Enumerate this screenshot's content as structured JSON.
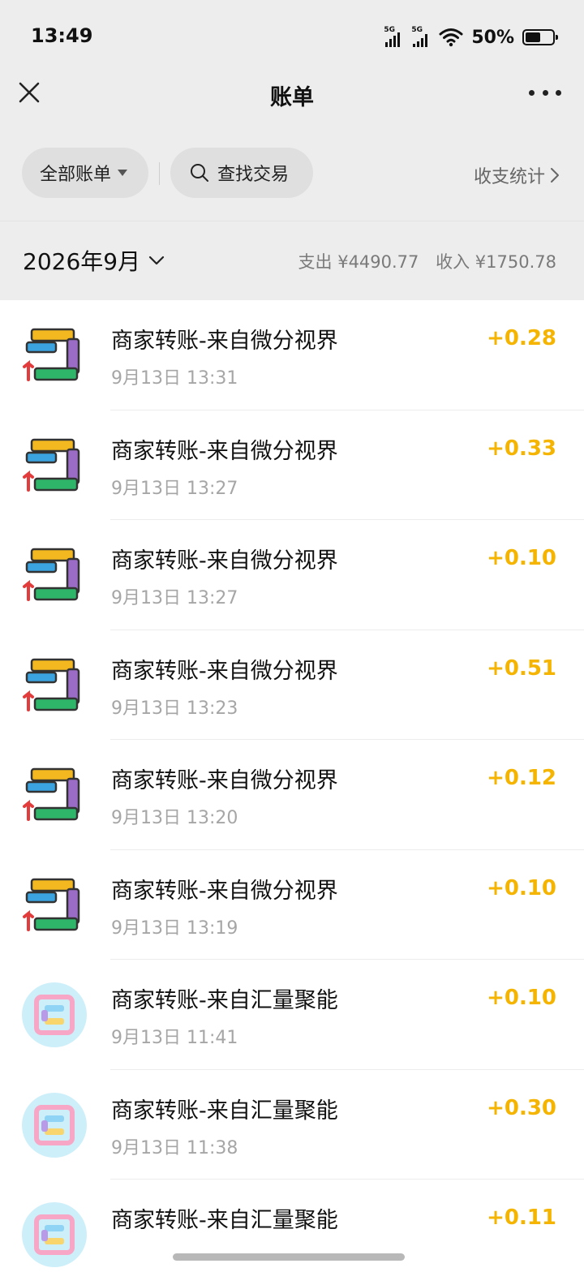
{
  "status_bar": {
    "time": "13:49",
    "signal_1": "5G",
    "signal_2": "5G",
    "battery": "50%"
  },
  "nav": {
    "title": "账单"
  },
  "filters": {
    "all_bills": "全部账单",
    "search": "查找交易",
    "stats": "收支统计"
  },
  "month": {
    "label": "2026年9月",
    "expense": "支出 ¥4490.77",
    "income": "收入 ¥1750.78"
  },
  "transactions": [
    {
      "title": "商家转账-来自微分视界",
      "time": "9月13日 13:31",
      "amount": "+0.28",
      "icon": "arrows-square-icon"
    },
    {
      "title": "商家转账-来自微分视界",
      "time": "9月13日 13:27",
      "amount": "+0.33",
      "icon": "arrows-square-icon"
    },
    {
      "title": "商家转账-来自微分视界",
      "time": "9月13日 13:27",
      "amount": "+0.10",
      "icon": "arrows-square-icon"
    },
    {
      "title": "商家转账-来自微分视界",
      "time": "9月13日 13:23",
      "amount": "+0.51",
      "icon": "arrows-square-icon"
    },
    {
      "title": "商家转账-来自微分视界",
      "time": "9月13日 13:20",
      "amount": "+0.12",
      "icon": "arrows-square-icon"
    },
    {
      "title": "商家转账-来自微分视界",
      "time": "9月13日 13:19",
      "amount": "+0.10",
      "icon": "arrows-square-icon"
    },
    {
      "title": "商家转账-来自汇量聚能",
      "time": "9月13日 11:41",
      "amount": "+0.10",
      "icon": "maze-circle-icon"
    },
    {
      "title": "商家转账-来自汇量聚能",
      "time": "9月13日 11:38",
      "amount": "+0.30",
      "icon": "maze-circle-icon"
    },
    {
      "title": "商家转账-来自汇量聚能",
      "time": "",
      "amount": "+0.11",
      "icon": "maze-circle-icon"
    }
  ],
  "colors": {
    "amount": "#f5b400",
    "background": "#ededed"
  }
}
